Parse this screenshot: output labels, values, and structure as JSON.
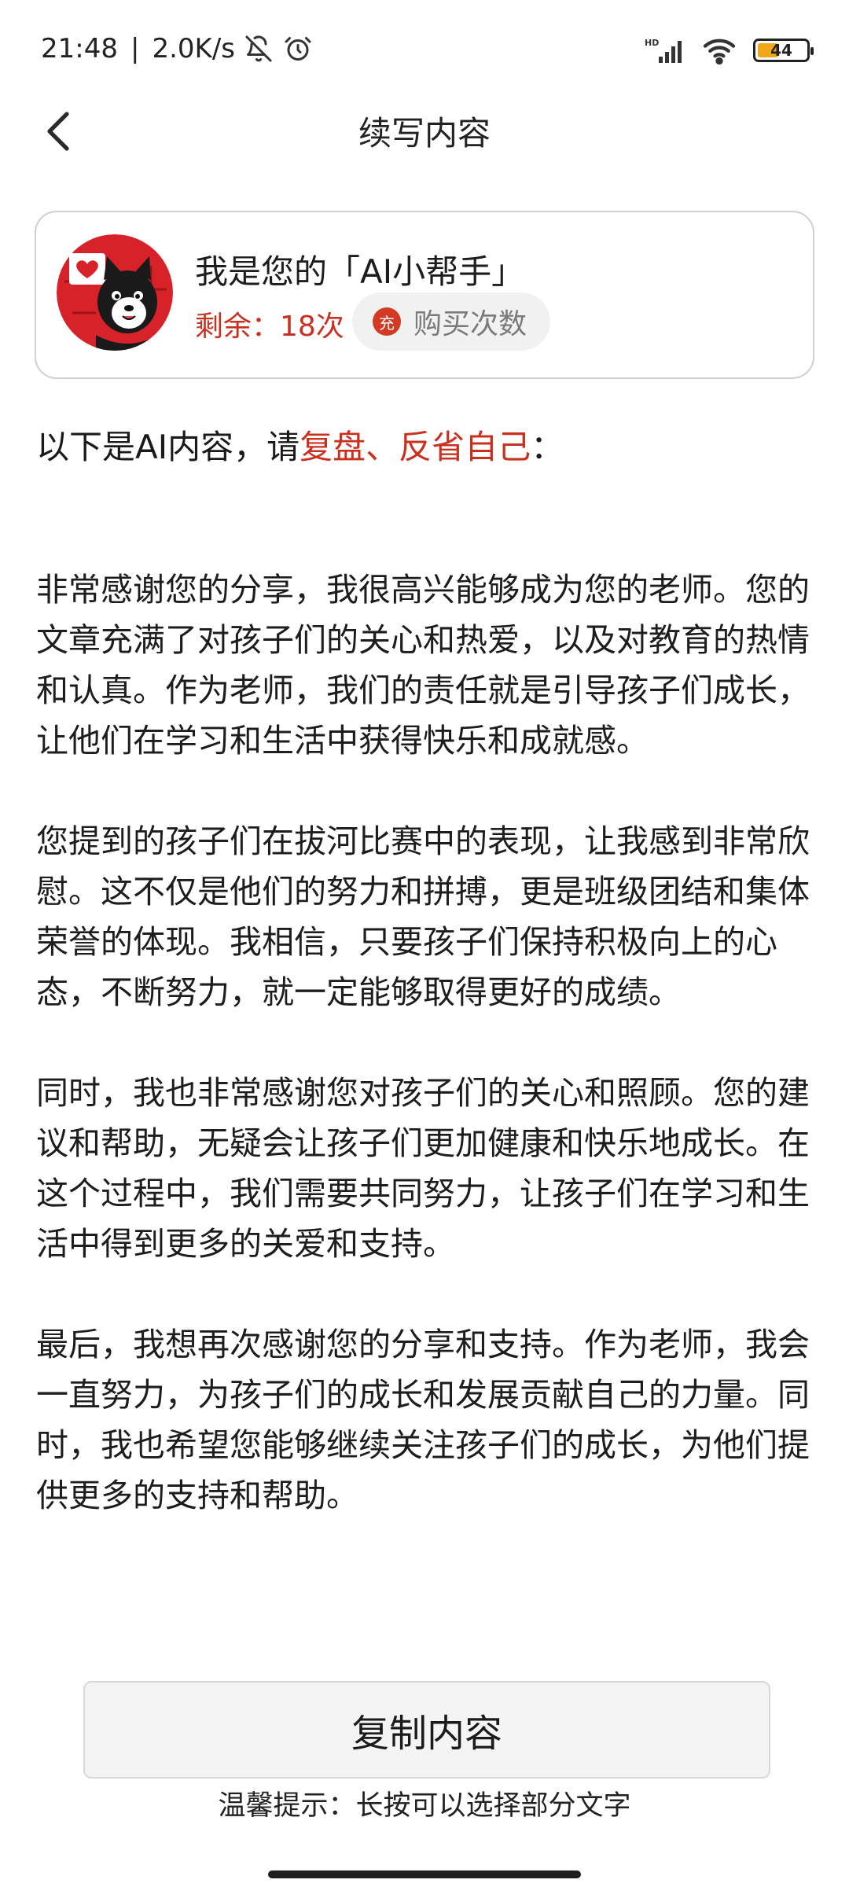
{
  "status_bar": {
    "time": "21:48",
    "network_speed": "2.0K/s",
    "network_type": "HD",
    "battery_level": "44",
    "battery_percent": 44,
    "icons": [
      "bell-off-icon",
      "alarm-icon",
      "signal-icon",
      "wifi-icon",
      "battery-icon"
    ]
  },
  "header": {
    "title": "续写内容",
    "back_icon": "chevron-left-icon"
  },
  "assistant_card": {
    "title": "我是您的「AI小帮手」",
    "remaining": "剩余：18次",
    "buy_label": "购买次数",
    "charge_badge": "充",
    "avatar_icon": "dog-avatar-icon",
    "colors": {
      "accent": "#c8301f",
      "avatar_bg": "#d8222a"
    }
  },
  "intro": {
    "prefix": "以下是AI内容，请",
    "highlight": "复盘、反省自己",
    "suffix": "："
  },
  "content": {
    "paragraphs": [
      "非常感谢您的分享，我很高兴能够成为您的老师。您的文章充满了对孩子们的关心和热爱，以及对教育的热情和认真。作为老师，我们的责任就是引导孩子们成长，让他们在学习和生活中获得快乐和成就感。",
      "您提到的孩子们在拔河比赛中的表现，让我感到非常欣慰。这不仅是他们的努力和拼搏，更是班级团结和集体荣誉的体现。我相信，只要孩子们保持积极向上的心态，不断努力，就一定能够取得更好的成绩。",
      "同时，我也非常感谢您对孩子们的关心和照顾。您的建议和帮助，无疑会让孩子们更加健康和快乐地成长。在这个过程中，我们需要共同努力，让孩子们在学习和生活中得到更多的关爱和支持。",
      "最后，我想再次感谢您的分享和支持。作为老师，我会一直努力，为孩子们的成长和发展贡献自己的力量。同时，我也希望您能够继续关注孩子们的成长，为他们提供更多的支持和帮助。"
    ]
  },
  "actions": {
    "copy_label": "复制内容",
    "tip": "温馨提示：长按可以选择部分文字"
  }
}
